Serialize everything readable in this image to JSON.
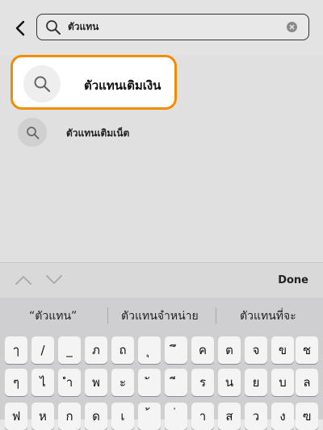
{
  "search": {
    "query": "ตัวแทน"
  },
  "results": [
    {
      "label": "ตัวแทนเติมเงิน",
      "highlighted": true
    },
    {
      "label": "ตัวแทนเติมเน็ต",
      "highlighted": false
    }
  ],
  "accessory": {
    "done_label": "Done"
  },
  "suggestions": [
    "“ตัวแทน”",
    "ตัวแทนจำหน่าย",
    "ตัวแทนที่จะ"
  ],
  "keyboard": {
    "row1": [
      "ๅ",
      "/",
      "_",
      "ภ",
      "ถ",
      "ุ",
      "ึ",
      "ค",
      "ต",
      "จ",
      "ข",
      "ช"
    ],
    "row2": [
      "ๆ",
      "ไ",
      "ำ",
      "พ",
      "ะ",
      "ั",
      "ี",
      "ร",
      "น",
      "ย",
      "บ",
      "ล"
    ],
    "row3": [
      "ฟ",
      "ห",
      "ก",
      "ด",
      "เ",
      "้",
      "่",
      "า",
      "ส",
      "ว",
      "ง",
      "ฃ"
    ]
  },
  "colors": {
    "highlight_border": "#f18d00"
  }
}
